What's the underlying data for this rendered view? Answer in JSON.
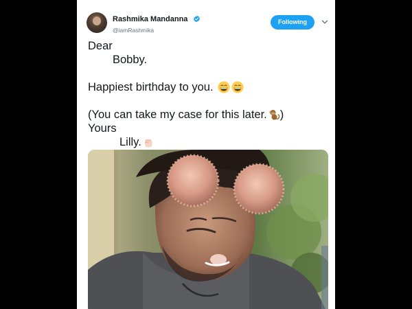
{
  "tweet": {
    "author": {
      "display_name": "Rashmika Mandanna",
      "handle": "@iamRashmika",
      "verified": true,
      "verified_icon": "verified-badge-icon",
      "avatar_icon": "profile-avatar"
    },
    "follow_button": {
      "label": "Following",
      "color": "#1da1f2"
    },
    "menu_icon": "chevron-down-icon",
    "text": {
      "line1": "Dear",
      "line2": "Bobby.",
      "line3": "Happiest birthday to you.",
      "line4": "(You can take my case for this later.",
      "line4_end": ")",
      "line5": "Yours",
      "line6": "Lilly."
    },
    "emojis": {
      "birthday_line": [
        "grinning-face-icon",
        "grinning-face-icon"
      ],
      "case_line": "monkey-icon",
      "sign_off": "raised-fist-icon"
    },
    "media": {
      "icon": "photo-with-filter-ears"
    }
  }
}
